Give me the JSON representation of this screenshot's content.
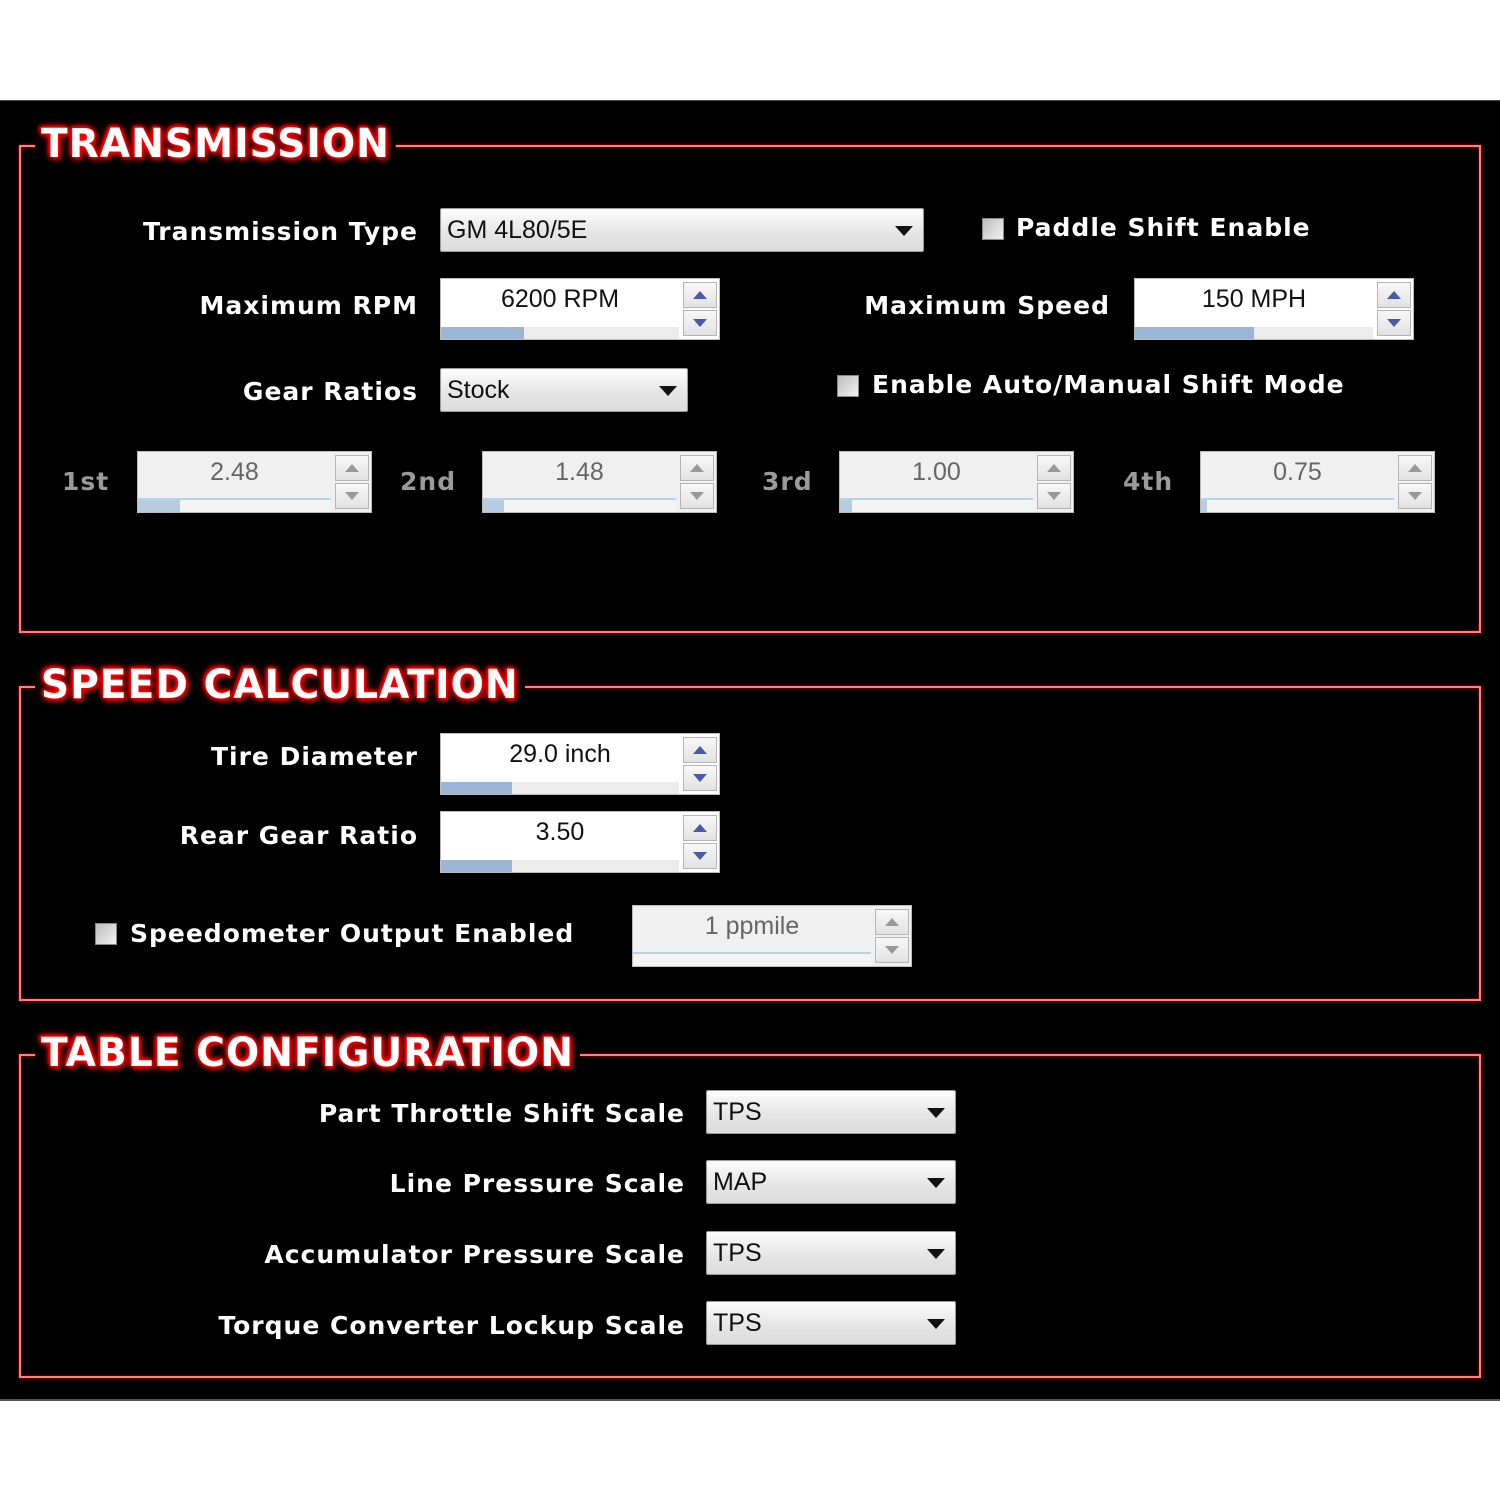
{
  "transmission": {
    "title": "TRANSMISSION",
    "type_label": "Transmission Type",
    "type_value": "GM 4L80/5E",
    "paddle_shift_label": "Paddle Shift Enable",
    "paddle_shift_checked": false,
    "max_rpm_label": "Maximum RPM",
    "max_rpm_value": "6200 RPM",
    "max_rpm_fill": 0.35,
    "max_speed_label": "Maximum Speed",
    "max_speed_value": "150 MPH",
    "max_speed_fill": 0.5,
    "gear_ratios_label": "Gear Ratios",
    "gear_ratios_value": "Stock",
    "auto_manual_label": "Enable Auto/Manual Shift Mode",
    "auto_manual_checked": false,
    "gears": [
      {
        "label": "1st",
        "value": "2.48",
        "fill": 0.22
      },
      {
        "label": "2nd",
        "value": "1.48",
        "fill": 0.11
      },
      {
        "label": "3rd",
        "value": "1.00",
        "fill": 0.06
      },
      {
        "label": "4th",
        "value": "0.75",
        "fill": 0.03
      }
    ]
  },
  "speed_calc": {
    "title": "SPEED CALCULATION",
    "tire_label": "Tire Diameter",
    "tire_value": "29.0 inch",
    "tire_fill": 0.3,
    "rear_gear_label": "Rear Gear Ratio",
    "rear_gear_value": "3.50",
    "rear_gear_fill": 0.3,
    "speedo_label": "Speedometer Output Enabled",
    "speedo_checked": false,
    "speedo_value": "1 ppmile",
    "speedo_fill": 0.0
  },
  "table_config": {
    "title": "TABLE CONFIGURATION",
    "rows": [
      {
        "label": "Part Throttle Shift Scale",
        "value": "TPS"
      },
      {
        "label": "Line Pressure Scale",
        "value": "MAP"
      },
      {
        "label": "Accumulator Pressure Scale",
        "value": "TPS"
      },
      {
        "label": "Torque Converter Lockup Scale",
        "value": "TPS"
      }
    ]
  },
  "colors": {
    "accent": "#ff0000",
    "border": "#ff8080",
    "background": "#000000"
  }
}
